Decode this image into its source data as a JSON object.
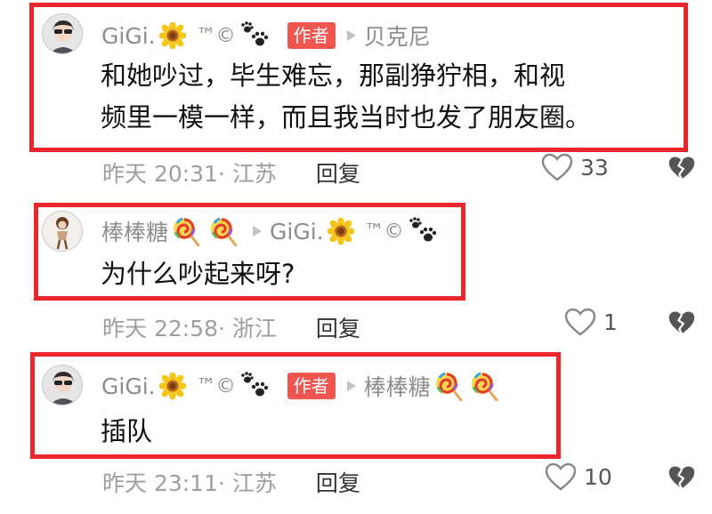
{
  "colors": {
    "highlight_border": "#e8262b",
    "author_badge": "#f0564f",
    "meta_text": "#9e9e9e"
  },
  "comments": [
    {
      "author": "GiGi.",
      "author_suffix": "™©",
      "author_badge": "作者",
      "reply_to": "贝克尼",
      "body_lines": [
        "和她吵过，毕生难忘，那副狰狞相，和视",
        "频里一模一样，而且我当时也发了朋友圈。"
      ],
      "time_location": "昨天 20:31· 江苏",
      "reply_label": "回复",
      "likes": "33",
      "icons": [
        "sunflower-icon",
        "paw-prints-icon",
        "play-triangle-icon",
        "heart-outline-icon",
        "broken-heart-icon"
      ]
    },
    {
      "author": "棒棒糖",
      "reply_to": "GiGi.",
      "reply_to_suffix": "™©",
      "body_lines": [
        "为什么吵起来呀?"
      ],
      "time_location": "昨天 22:58· 浙江",
      "reply_label": "回复",
      "likes": "1",
      "icons": [
        "lollipop-icon",
        "sunflower-icon",
        "paw-prints-icon",
        "heart-outline-icon",
        "broken-heart-icon"
      ]
    },
    {
      "author": "GiGi.",
      "author_suffix": "™©",
      "author_badge": "作者",
      "reply_to": "棒棒糖",
      "body_lines": [
        "插队"
      ],
      "time_location": "昨天 23:11· 江苏",
      "reply_label": "回复",
      "likes": "10",
      "icons": [
        "sunflower-icon",
        "paw-prints-icon",
        "lollipop-icon",
        "heart-outline-icon",
        "broken-heart-icon"
      ]
    }
  ]
}
